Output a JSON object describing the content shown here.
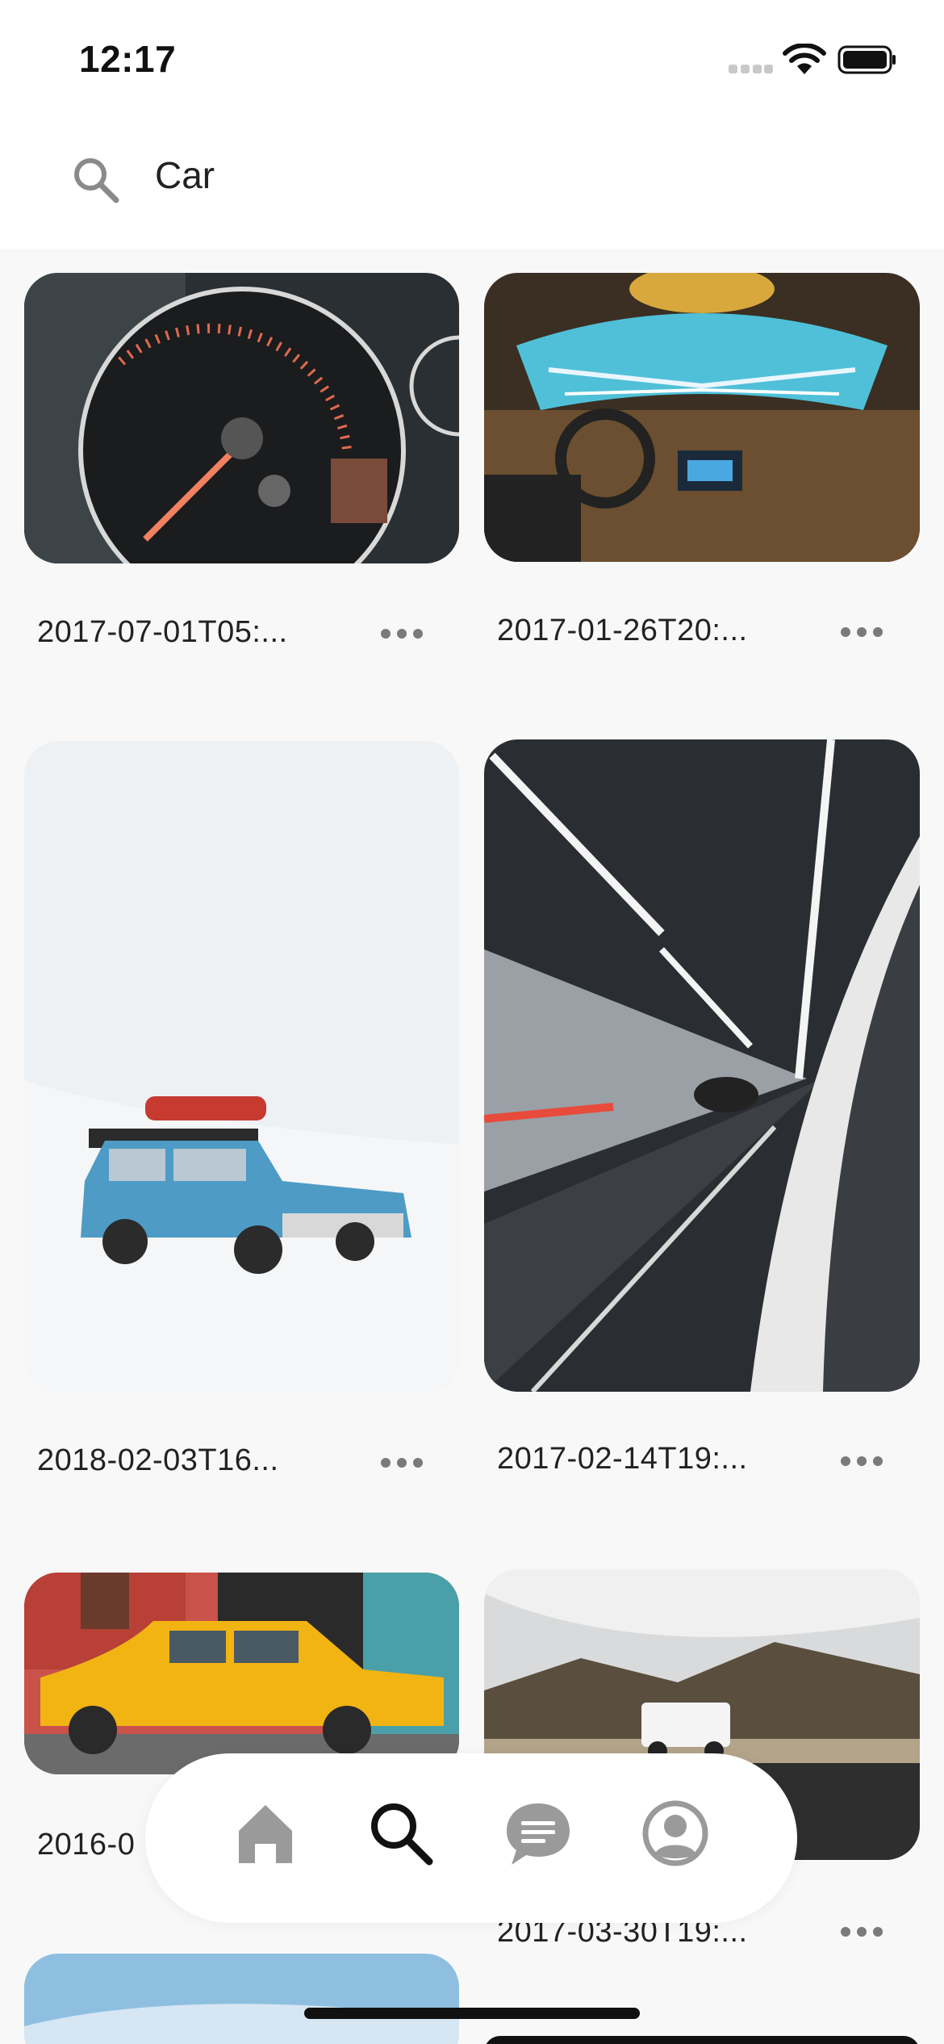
{
  "status_bar": {
    "time": "12:17",
    "icons": [
      "signal-icon",
      "wifi-icon",
      "battery-icon"
    ]
  },
  "search": {
    "query": "Car",
    "icon": "search-icon"
  },
  "results": [
    {
      "caption": "2017-07-01T05:...",
      "subject": "speedometer dashboard"
    },
    {
      "caption": "2017-01-26T20:...",
      "subject": "car interior with light trails"
    },
    {
      "caption": "2018-02-03T16...",
      "subject": "blue vintage car in snow"
    },
    {
      "caption": "2017-02-14T19:...",
      "subject": "white car in tunnel"
    },
    {
      "caption": "2016-0",
      "subject": "yellow vintage car"
    },
    {
      "caption": "2017-03-30T19:...",
      "subject": "white SUV in landscape"
    }
  ],
  "tab_bar": {
    "items": [
      {
        "name": "home",
        "icon": "home-icon",
        "active": false
      },
      {
        "name": "search",
        "icon": "search-icon",
        "active": true
      },
      {
        "name": "messages",
        "icon": "chat-icon",
        "active": false
      },
      {
        "name": "profile",
        "icon": "account-icon",
        "active": false
      }
    ]
  },
  "colors": {
    "background": "#f8f8f8",
    "surface": "#ffffff",
    "active_icon": "#111111",
    "inactive_icon": "#9a9a9a"
  }
}
